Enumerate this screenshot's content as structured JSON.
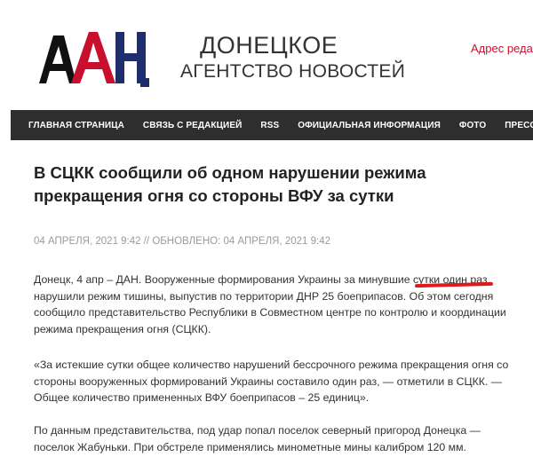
{
  "site": {
    "logo_text": "ДАН",
    "brand_line1": "ДОНЕЦКОЕ",
    "brand_line2": "АГЕНТСТВО НОВОСТЕЙ",
    "address_label": "Адрес реда"
  },
  "nav": {
    "items": [
      {
        "label": "ГЛАВНАЯ СТРАНИЦА"
      },
      {
        "label": "СВЯЗЬ С РЕДАКЦИЕЙ"
      },
      {
        "label": "RSS"
      },
      {
        "label": "ОФИЦИАЛЬНАЯ ИНФОРМАЦИЯ"
      },
      {
        "label": "ФОТО"
      },
      {
        "label": "ПРЕСС-ЦЕНТР"
      }
    ]
  },
  "article": {
    "title": "В СЦКК сообщили об одном нарушении режима прекращения огня со стороны ВФУ за сутки",
    "meta": "04 АПРЕЛЯ, 2021 9:42 // ОБНОВЛЕНО: 04 АПРЕЛЯ, 2021 9:42",
    "paragraph1": "Донецк, 4 апр – ДАН. Вооруженные формирования Украины за минувшие сутки один раз нарушили режим тишины, выпустив по территории ДНР 25 боеприпасов. Об этом сегодня сообщило представительство Республики в Совместном центре по контролю и координации режима прекращения огня (СЦКК).",
    "paragraph2": "«За истекшие сутки общее количество нарушений бессрочного режима прекращения огня со стороны вооруженных формирований Украины составило один раз, — отметили в СЦКК. — Общее количество примененных ВФУ боеприпасов – 25 единиц».",
    "paragraph3": "По данным представительства, под удар попал поселок северный пригород Донецка — поселок Жабуньки. При обстреле применялись минометные мины калибром 120 мм."
  },
  "colors": {
    "nav_bg": "#2e2e2e",
    "accent_red": "#c8102e",
    "logo_blue": "#1e2d6b",
    "logo_black": "#111111",
    "underline_red": "#e01a1a"
  }
}
